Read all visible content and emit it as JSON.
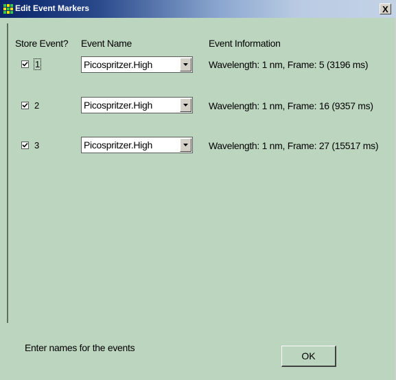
{
  "window": {
    "title": "Edit Event Markers",
    "close_glyph": "X",
    "icon": "app-grid-icon"
  },
  "columns": {
    "store": "Store Event?",
    "name": "Event Name",
    "info": "Event Information"
  },
  "rows": [
    {
      "checked": true,
      "number": "1",
      "event_name": "Picospritzer.High",
      "info": "Wavelength: 1 nm, Frame: 5 (3196 ms)"
    },
    {
      "checked": true,
      "number": "2",
      "event_name": "Picospritzer.High",
      "info": "Wavelength: 1 nm, Frame: 16 (9357 ms)"
    },
    {
      "checked": true,
      "number": "3",
      "event_name": "Picospritzer.High",
      "info": "Wavelength: 1 nm, Frame: 27 (15517 ms)"
    }
  ],
  "footer": {
    "status": "Enter names for the events",
    "ok_label": "OK"
  },
  "colors": {
    "background": "#bcd5bf",
    "title_start": "#0a246a",
    "title_end": "#c4d2e6"
  }
}
